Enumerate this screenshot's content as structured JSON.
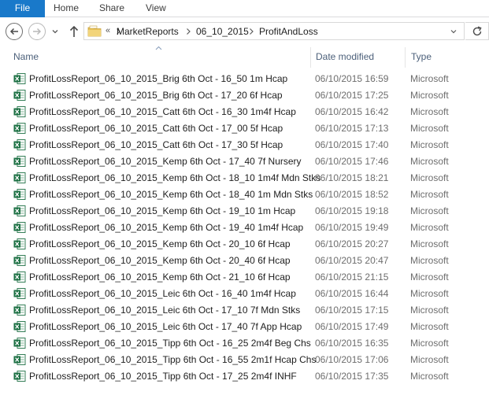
{
  "ribbon": {
    "tabs": [
      "File",
      "Home",
      "Share",
      "View"
    ]
  },
  "navigation": {
    "back_icon": "arrow-left-icon",
    "forward_icon": "arrow-right-icon",
    "up_icon": "arrow-up-icon",
    "overflow": "«",
    "breadcrumbs": [
      "MarketReports",
      "06_10_2015",
      "ProfitAndLoss"
    ]
  },
  "columns": {
    "name": "Name",
    "date": "Date modified",
    "type": "Type"
  },
  "files": [
    {
      "name": "ProfitLossReport_06_10_2015_Brig 6th Oct - 16_50 1m Hcap",
      "date": "06/10/2015 16:59",
      "type": "Microsoft"
    },
    {
      "name": "ProfitLossReport_06_10_2015_Brig 6th Oct - 17_20 6f Hcap",
      "date": "06/10/2015 17:25",
      "type": "Microsoft"
    },
    {
      "name": "ProfitLossReport_06_10_2015_Catt 6th Oct - 16_30 1m4f Hcap",
      "date": "06/10/2015 16:42",
      "type": "Microsoft"
    },
    {
      "name": "ProfitLossReport_06_10_2015_Catt 6th Oct - 17_00 5f Hcap",
      "date": "06/10/2015 17:13",
      "type": "Microsoft"
    },
    {
      "name": "ProfitLossReport_06_10_2015_Catt 6th Oct - 17_30 5f Hcap",
      "date": "06/10/2015 17:40",
      "type": "Microsoft"
    },
    {
      "name": "ProfitLossReport_06_10_2015_Kemp 6th Oct - 17_40 7f Nursery",
      "date": "06/10/2015 17:46",
      "type": "Microsoft"
    },
    {
      "name": "ProfitLossReport_06_10_2015_Kemp 6th Oct - 18_10 1m4f Mdn Stks",
      "date": "06/10/2015 18:21",
      "type": "Microsoft"
    },
    {
      "name": "ProfitLossReport_06_10_2015_Kemp 6th Oct - 18_40 1m Mdn Stks",
      "date": "06/10/2015 18:52",
      "type": "Microsoft"
    },
    {
      "name": "ProfitLossReport_06_10_2015_Kemp 6th Oct - 19_10 1m Hcap",
      "date": "06/10/2015 19:18",
      "type": "Microsoft"
    },
    {
      "name": "ProfitLossReport_06_10_2015_Kemp 6th Oct - 19_40 1m4f Hcap",
      "date": "06/10/2015 19:49",
      "type": "Microsoft"
    },
    {
      "name": "ProfitLossReport_06_10_2015_Kemp 6th Oct - 20_10 6f Hcap",
      "date": "06/10/2015 20:27",
      "type": "Microsoft"
    },
    {
      "name": "ProfitLossReport_06_10_2015_Kemp 6th Oct - 20_40 6f Hcap",
      "date": "06/10/2015 20:47",
      "type": "Microsoft"
    },
    {
      "name": "ProfitLossReport_06_10_2015_Kemp 6th Oct - 21_10 6f Hcap",
      "date": "06/10/2015 21:15",
      "type": "Microsoft"
    },
    {
      "name": "ProfitLossReport_06_10_2015_Leic 6th Oct - 16_40 1m4f Hcap",
      "date": "06/10/2015 16:44",
      "type": "Microsoft"
    },
    {
      "name": "ProfitLossReport_06_10_2015_Leic 6th Oct - 17_10 7f Mdn Stks",
      "date": "06/10/2015 17:15",
      "type": "Microsoft"
    },
    {
      "name": "ProfitLossReport_06_10_2015_Leic 6th Oct - 17_40 7f App Hcap",
      "date": "06/10/2015 17:49",
      "type": "Microsoft"
    },
    {
      "name": "ProfitLossReport_06_10_2015_Tipp 6th Oct - 16_25 2m4f Beg Chs",
      "date": "06/10/2015 16:35",
      "type": "Microsoft"
    },
    {
      "name": "ProfitLossReport_06_10_2015_Tipp 6th Oct - 16_55 2m1f Hcap Chs",
      "date": "06/10/2015 17:06",
      "type": "Microsoft"
    },
    {
      "name": "ProfitLossReport_06_10_2015_Tipp 6th Oct - 17_25 2m4f INHF",
      "date": "06/10/2015 17:35",
      "type": "Microsoft"
    }
  ],
  "file_icon": "excel-file-icon",
  "colors": {
    "file_tab": "#1979ca",
    "excel_green": "#1e7145",
    "folder_yellow": "#e8c25a",
    "header_text": "#4c607a",
    "meta_text": "#6d6d6d"
  }
}
